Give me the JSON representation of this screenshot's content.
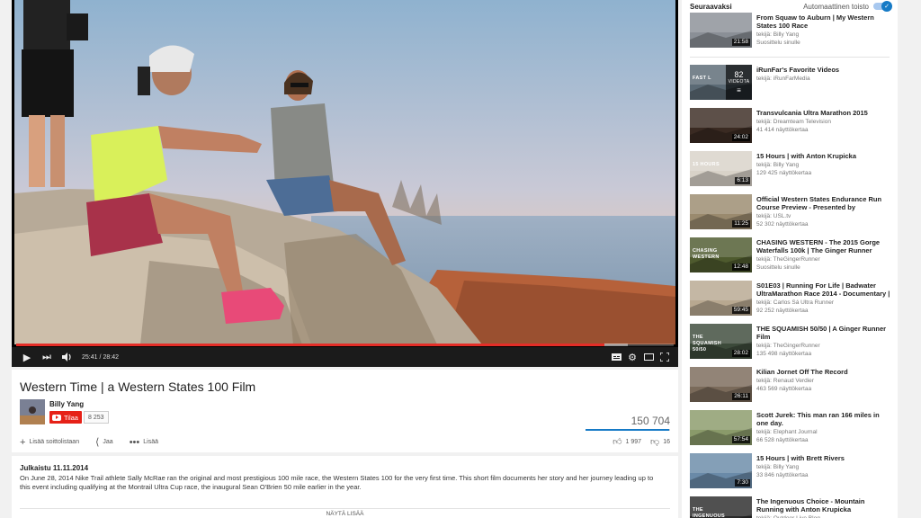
{
  "player": {
    "current_time": "25:41",
    "duration": "28:42",
    "progress_fraction": 0.894,
    "loaded_fraction": 0.93,
    "icons": [
      "play-icon",
      "next-icon",
      "volume-icon",
      "subtitles-icon",
      "settings-icon",
      "theater-icon",
      "fullscreen-icon"
    ]
  },
  "video": {
    "title": "Western Time | a Western States 100 Film",
    "channel": "Billy Yang",
    "subscribe_label": "Tilaa",
    "subscriber_count": "8 253",
    "view_count": "150 704",
    "like_ratio": 0.992,
    "actions": {
      "add_to": "Lisää soittolistaan",
      "share": "Jaa",
      "more": "Lisää"
    },
    "likes": "1 997",
    "dislikes": "16"
  },
  "description": {
    "published": "Julkaistu 11.11.2014",
    "text": "On June 28, 2014 Nike Trail athlete Sally McRae ran the original and most prestigious 100 mile race, the Western States 100 for the very first time. This short film documents her story and her journey leading up to this event including qualifying at the Montrail Ultra Cup race, the inaugural Sean O'Brien 50 mile earlier in the year.",
    "show_more": "NÄYTÄ LISÄÄ"
  },
  "sidebar": {
    "up_next_label": "Seuraavaksi",
    "autoplay_label": "Automaattinen toisto",
    "autoplay_on": true,
    "accent_color": "#167ac6",
    "items": [
      {
        "title": "From Squaw to Auburn | My Western States 100 Race",
        "channel": "tekijä: Billy Yang",
        "meta": "Suosittelu sinulle",
        "duration": "21:58",
        "thumb_color": "#8a8f96"
      },
      {
        "title": "iRunFar's Favorite Videos",
        "channel": "tekijä: iRunFarMedia",
        "meta": "",
        "duration": "",
        "playlist_count": "82",
        "playlist_label": "VIDEOTA",
        "thumb_text": "FAST L",
        "thumb_color": "#5b6a75"
      },
      {
        "title": "Transvulcania Ultra Marathon 2015",
        "channel": "tekijä: Dreamteam Television",
        "meta": "41 414 näyttökertaa",
        "duration": "24:02",
        "thumb_color": "#3a2a22"
      },
      {
        "title": "15 Hours | with Anton Krupicka",
        "channel": "tekijä: Billy Yang",
        "meta": "129 425 näyttökertaa",
        "duration": "6:13",
        "thumb_text": "15 HOURS",
        "thumb_color": "#d8d2c8"
      },
      {
        "title": "Official Western States Endurance Run Course Preview - Presented by",
        "channel": "tekijä: USL.tv",
        "meta": "52 302 näyttökertaa",
        "duration": "11:25",
        "thumb_color": "#9a8a6e"
      },
      {
        "title": "CHASING WESTERN - The 2015 Gorge Waterfalls 100k | The Ginger Runner",
        "channel": "tekijä: TheGingerRunner",
        "meta": "Suosittelu sinulle",
        "duration": "12:48",
        "thumb_text": "CHASING WESTERN",
        "thumb_color": "#4e5a2e"
      },
      {
        "title": "S01E03 | Running For Life | Badwater UltraMarathon Race 2014 - Documentary |",
        "channel": "tekijä: Carlos Sá Ultra Runner",
        "meta": "92 252 näyttökertaa",
        "duration": "59:45",
        "thumb_color": "#b8a890"
      },
      {
        "title": "THE SQUAMISH 50/50 | A Ginger Runner Film",
        "channel": "tekijä: TheGingerRunner",
        "meta": "135 498 näyttökertaa",
        "duration": "28:02",
        "thumb_text": "THE SQUAMISH 50/50",
        "thumb_color": "#3c4a3a"
      },
      {
        "title": "Kilian Jornet Off The Record",
        "channel": "tekijä: Renaud Verdier",
        "meta": "463 569 näyttökertaa",
        "duration": "26:11",
        "thumb_color": "#7a6a5a"
      },
      {
        "title": "Scott Jurek: This man ran 166 miles in one day.",
        "channel": "tekijä: Elephant Journal",
        "meta": "66 528 näyttökertaa",
        "duration": "57:54",
        "thumb_color": "#8a9a6a"
      },
      {
        "title": "15 Hours | with Brett Rivers",
        "channel": "tekijä: Billy Yang",
        "meta": "33 846 näyttökertaa",
        "duration": "7:30",
        "thumb_color": "#6a8aa8"
      },
      {
        "title": "The Ingenuous Choice - Mountain Running with Anton Krupicka",
        "channel": "tekijä: Outdoor Live Blog",
        "meta": "",
        "duration": "",
        "thumb_text": "THE INGENUOUS CHOICE",
        "thumb_color": "#2a2a2a"
      }
    ]
  }
}
